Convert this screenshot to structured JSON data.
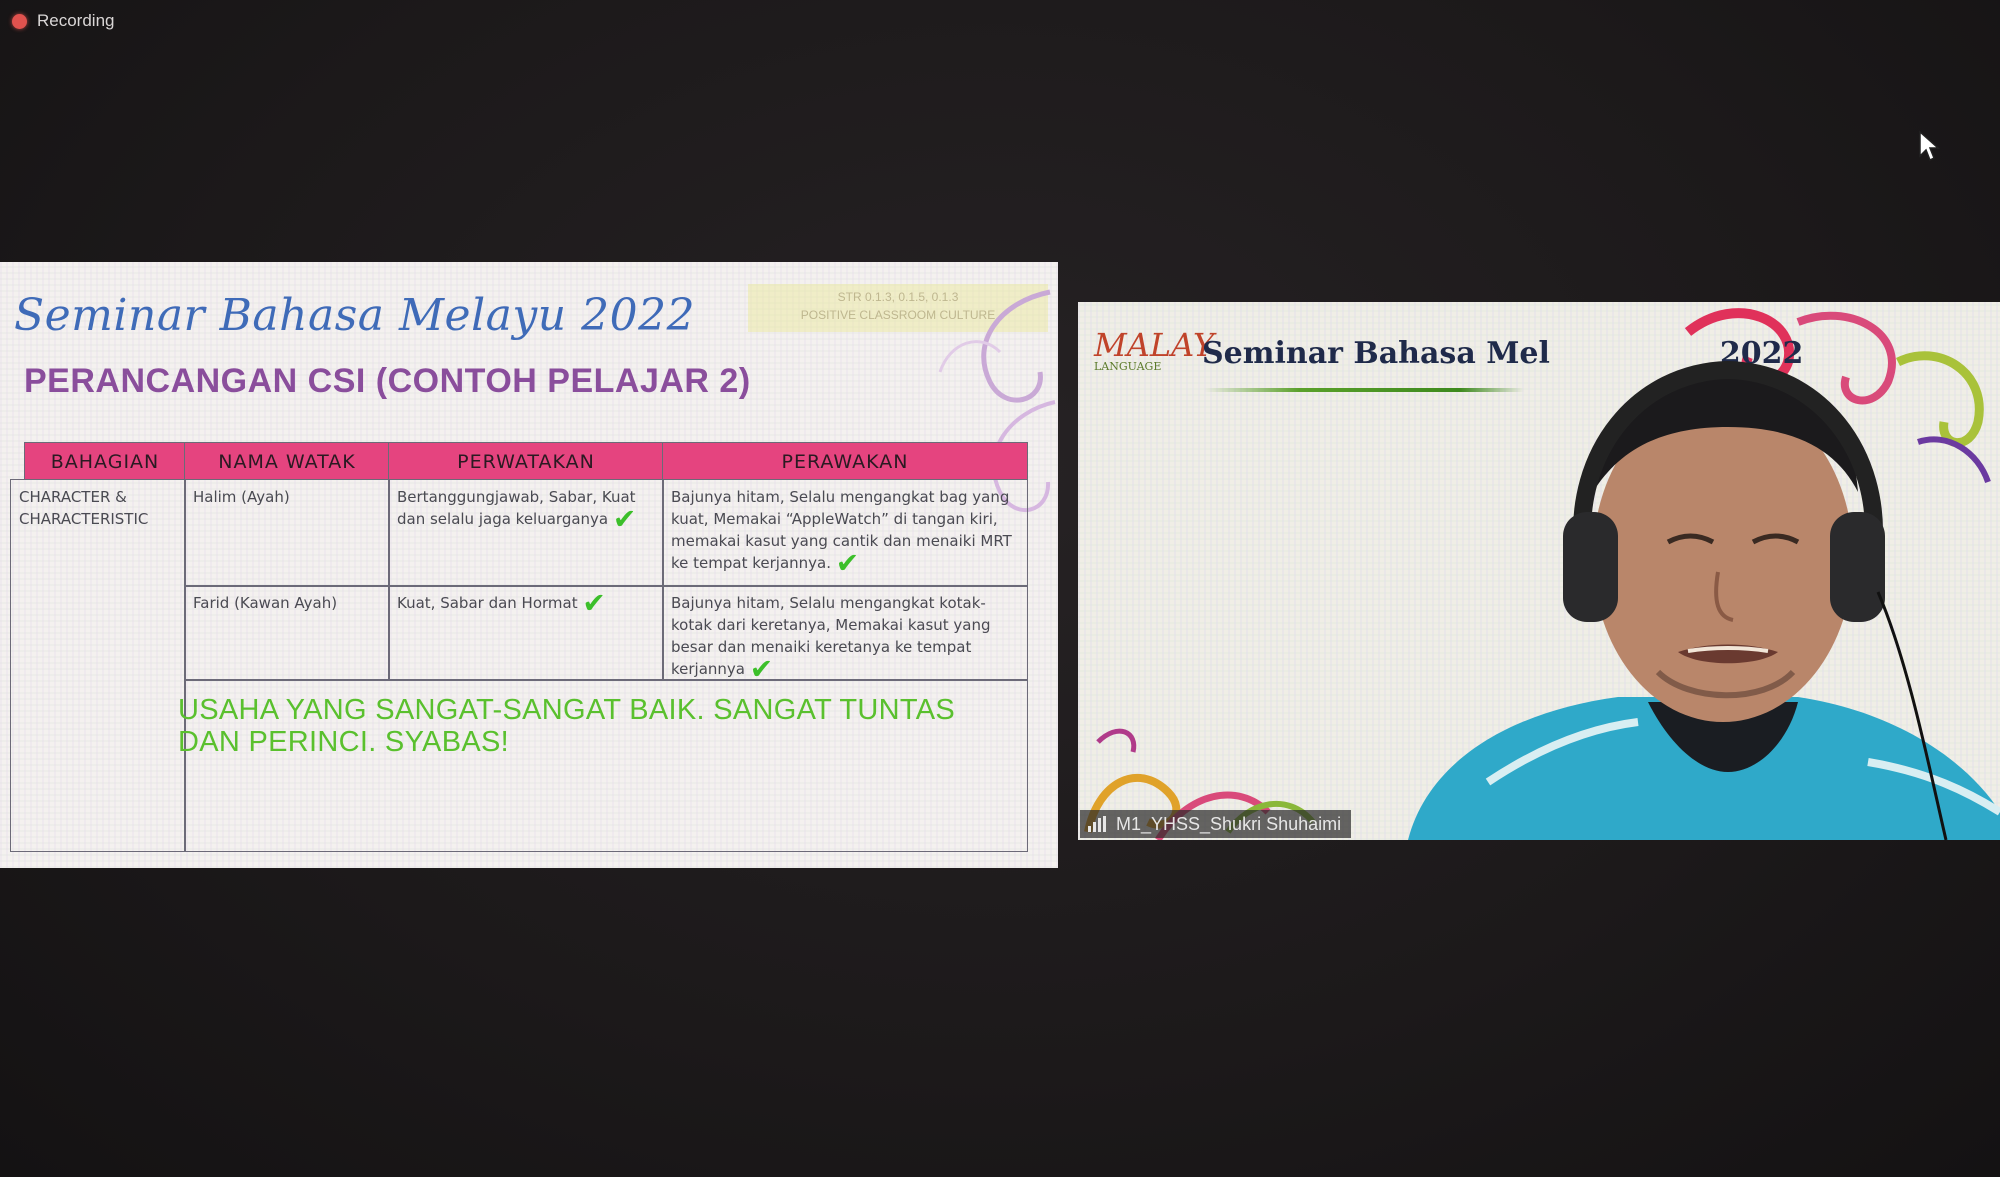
{
  "recording": {
    "label": "Recording"
  },
  "slide": {
    "title": "Seminar Bahasa Melayu 2022",
    "badge_line1": "STR 0.1.3, 0.1.5, 0.1.3",
    "badge_line2": "POSITIVE CLASSROOM CULTURE",
    "subtitle": "PERANCANGAN CSI (CONTOH PELAJAR 2)",
    "table": {
      "headers": [
        "BAHAGIAN",
        "NAMA WATAK",
        "PERWATAKAN",
        "PERAWAKAN"
      ],
      "section": "CHARACTER & CHARACTERISTIC",
      "rows": [
        {
          "name": "Halim (Ayah)",
          "perwatakan": "Bertanggungjawab, Sabar, Kuat dan selalu jaga keluarganya",
          "perawakan": "Bajunya hitam, Selalu mengangkat bag yang kuat, Memakai “AppleWatch” di tangan kiri, memakai kasut yang cantik dan menaiki MRT ke tempat kerjannya."
        },
        {
          "name": "Farid (Kawan Ayah)",
          "perwatakan": "Kuat, Sabar dan Hormat",
          "perawakan": "Bajunya hitam, Selalu mengangkat kotak-kotak dari keretanya, Memakai kasut yang besar dan menaiki keretanya ke tempat kerjannya"
        }
      ],
      "comment": "USAHA YANG SANGAT-SANGAT BAIK. SANGAT TUNTAS DAN PERINCI. SYABAS!"
    }
  },
  "camera": {
    "background_title": "Seminar Bahasa Mel",
    "background_title_tail": "2022",
    "logo_text": "MALAY",
    "logo_sub": "LANGUAGE",
    "participant_name": "M1_YHSS_Shukri Shuhaimi"
  },
  "colors": {
    "table_header": "#e5447f",
    "title_blue": "#3f6bb8",
    "subtitle_purple": "#8a4e9c",
    "comment_green": "#5ac02e",
    "recording_red": "#e0524e"
  }
}
